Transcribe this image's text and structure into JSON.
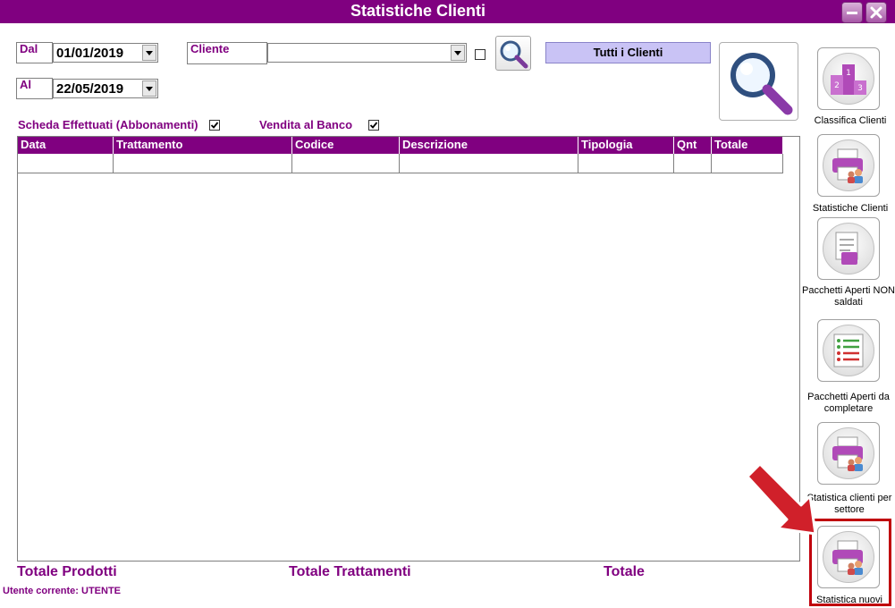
{
  "window": {
    "title": "Statistiche Clienti",
    "title_bar_color": "#800080",
    "minimize_icon": "minimize-icon",
    "close_icon": "close-icon"
  },
  "filters": {
    "dal_label": "Dal",
    "dal_value": "01/01/2019",
    "al_label": "Al",
    "al_value": "22/05/2019",
    "cliente_label": "Cliente",
    "cliente_value": "",
    "cliente_checkbox_checked": false,
    "tutti_label": "Tutti i Clienti"
  },
  "options": {
    "scheda_label": "Scheda Effettuati (Abbonamenti)",
    "scheda_checked": true,
    "vendita_label": "Vendita al Banco",
    "vendita_checked": true
  },
  "table": {
    "columns": [
      "Data",
      "Trattamento",
      "Codice",
      "Descrizione",
      "Tipologia",
      "Qnt",
      "Totale"
    ],
    "rows": []
  },
  "footer": {
    "totale_prodotti": "Totale Prodotti",
    "totale_trattamenti": "Totale Trattamenti",
    "totale": "Totale",
    "utente": "Utente corrente: UTENTE"
  },
  "sidebar": {
    "items": [
      {
        "label": "Classifica Clienti",
        "icon": "podium-icon"
      },
      {
        "label": "Statistiche Clienti",
        "icon": "printer-people-icon"
      },
      {
        "label": "Pacchetti Aperti NON saldati",
        "icon": "documents-icon"
      },
      {
        "label": "Pacchetti Aperti da completare",
        "icon": "checklist-icon"
      },
      {
        "label": "Statistica clienti per settore",
        "icon": "printer-people-icon"
      },
      {
        "label": "Statistica nuovi",
        "icon": "printer-people-icon"
      }
    ]
  },
  "colors": {
    "accent": "#800080",
    "tutti_button": "#c9c3f5",
    "highlight": "#c0000c"
  }
}
